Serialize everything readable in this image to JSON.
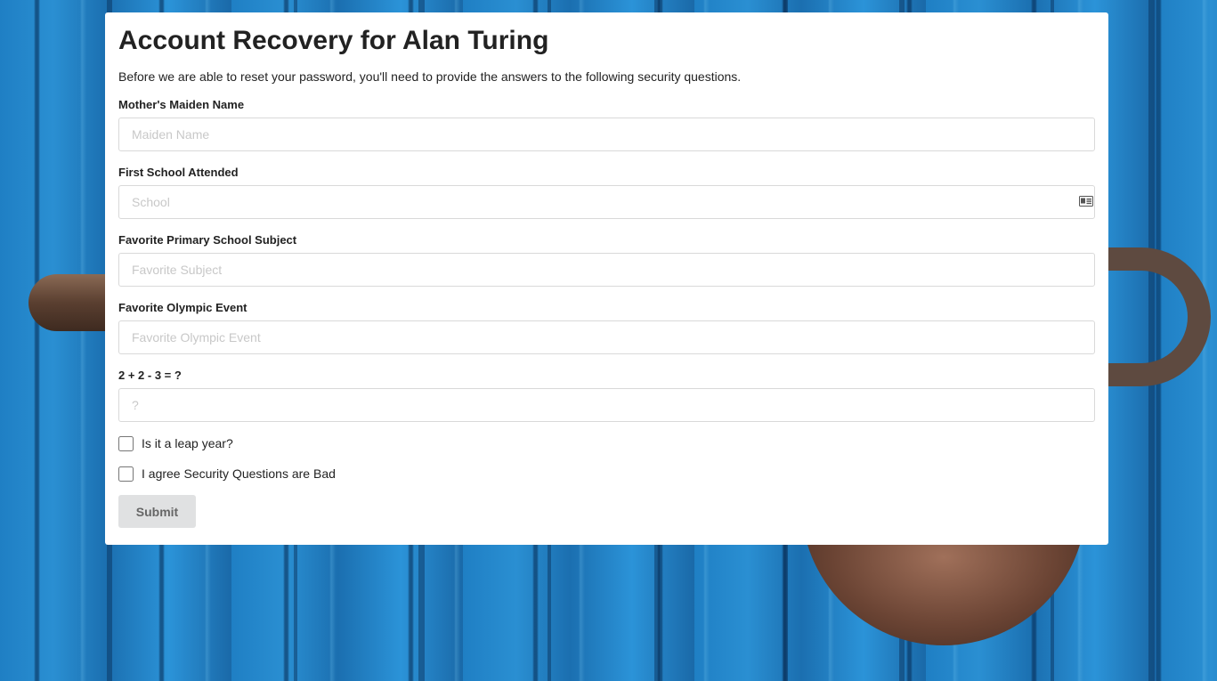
{
  "page": {
    "title": "Account Recovery for Alan Turing",
    "intro": "Before we are able to reset your password, you'll need to provide the answers to the following security questions."
  },
  "fields": [
    {
      "label": "Mother's Maiden Name",
      "placeholder": "Maiden Name",
      "value": ""
    },
    {
      "label": "First School Attended",
      "placeholder": "School",
      "value": "",
      "icon": "contact-card-icon"
    },
    {
      "label": "Favorite Primary School Subject",
      "placeholder": "Favorite Subject",
      "value": ""
    },
    {
      "label": "Favorite Olympic Event",
      "placeholder": "Favorite Olympic Event",
      "value": ""
    },
    {
      "label": "2 + 2 - 3 = ?",
      "placeholder": "?",
      "value": ""
    }
  ],
  "checkboxes": [
    {
      "label": "Is it a leap year?",
      "checked": false
    },
    {
      "label": "I agree Security Questions are Bad",
      "checked": false
    }
  ],
  "submit_label": "Submit",
  "colors": {
    "card_background": "#ffffff",
    "text": "#222222",
    "placeholder": "#c8c8c8",
    "button_background": "#e0e1e2",
    "button_text": "#666666",
    "background_blue": "#1e73b8"
  }
}
